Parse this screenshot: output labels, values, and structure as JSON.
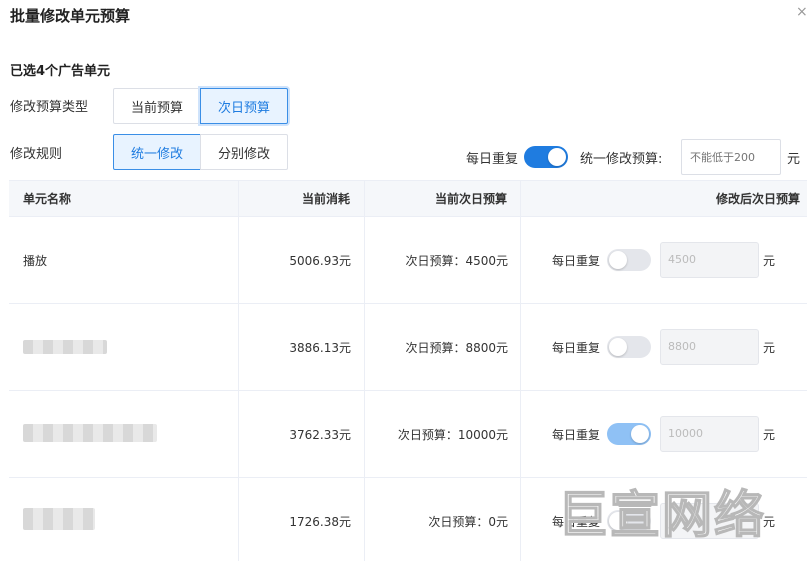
{
  "title": "批量修改单元预算",
  "close_icon": "×",
  "selected_count": "已选4个广告单元",
  "budget_type": {
    "label": "修改预算类型",
    "options": [
      "当前预算",
      "次日预算"
    ],
    "selected": "次日预算"
  },
  "rule": {
    "label": "修改规则",
    "options": [
      "统一修改",
      "分别修改"
    ],
    "selected": "统一修改"
  },
  "daily_repeat": {
    "label": "每日重复",
    "on": true
  },
  "unified_budget": {
    "label": "统一修改预算:",
    "placeholder": "不能低于200",
    "unit": "元"
  },
  "table": {
    "headers": [
      "单元名称",
      "当前消耗",
      "当前次日预算",
      "修改后次日预算"
    ],
    "rows": [
      {
        "name": "播放",
        "cost": "5006.93元",
        "next_budget": "次日预算：4500元",
        "daily_label": "每日重复",
        "daily_on": false,
        "input_value": "4500",
        "unit": "元"
      },
      {
        "name": "",
        "cost": "3886.13元",
        "next_budget": "次日预算：8800元",
        "daily_label": "每日重复",
        "daily_on": false,
        "input_value": "8800",
        "unit": "元"
      },
      {
        "name": "",
        "cost": "3762.33元",
        "next_budget": "次日预算：10000元",
        "daily_label": "每日重复",
        "daily_on": true,
        "input_value": "10000",
        "unit": "元"
      },
      {
        "name": "",
        "cost": "1726.38元",
        "next_budget": "次日预算：0元",
        "daily_label": "每日重复",
        "daily_on": false,
        "input_value": "",
        "unit": "元"
      }
    ]
  },
  "watermark": "巨宣网络",
  "colors": {
    "primary": "#1f7ce0",
    "active_bg": "#e8f3ff",
    "header_bg": "#f5f7fa",
    "toggle_off": "#e4e6eb"
  }
}
